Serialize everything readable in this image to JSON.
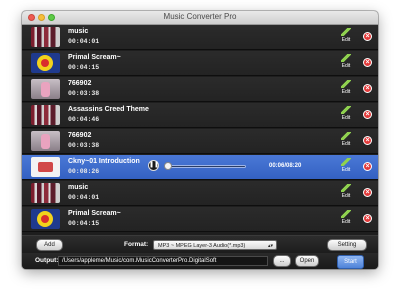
{
  "window": {
    "title": "Music Converter Pro"
  },
  "rows": [
    {
      "name": "music",
      "duration": "00:04:01",
      "thumb": "bars",
      "selected": false
    },
    {
      "name": "Primal Scream~",
      "duration": "00:04:15",
      "thumb": "blue",
      "selected": false
    },
    {
      "name": "766902",
      "duration": "00:03:38",
      "thumb": "pink",
      "selected": false
    },
    {
      "name": "Assassins Creed Theme",
      "duration": "00:04:46",
      "thumb": "bars",
      "selected": false
    },
    {
      "name": "766902",
      "duration": "00:03:38",
      "thumb": "pink",
      "selected": false
    },
    {
      "name": "Ckny~01 Introduction",
      "duration": "00:08:26",
      "thumb": "white",
      "selected": true
    },
    {
      "name": "music",
      "duration": "00:04:01",
      "thumb": "bars",
      "selected": false
    },
    {
      "name": "Primal Scream~",
      "duration": "00:04:15",
      "thumb": "blue",
      "selected": false
    }
  ],
  "row_actions": {
    "edit_label": "Edit",
    "delete_glyph": "×"
  },
  "player": {
    "time": "00:06/08:20",
    "play_glyph": "❚❚",
    "progress": 0.02
  },
  "toolbar": {
    "add_label": "Add",
    "format_label": "Format:",
    "format_value": "MP3 ~ MPEG Layer-3 Audio(*.mp3)",
    "setting_label": "Setting"
  },
  "output": {
    "label": "Output:",
    "path": "/Users/appleme/Music/com.MusicConverterPro.DigitalSoft",
    "browse_label": "...",
    "open_label": "Open",
    "start_label": "Start"
  }
}
